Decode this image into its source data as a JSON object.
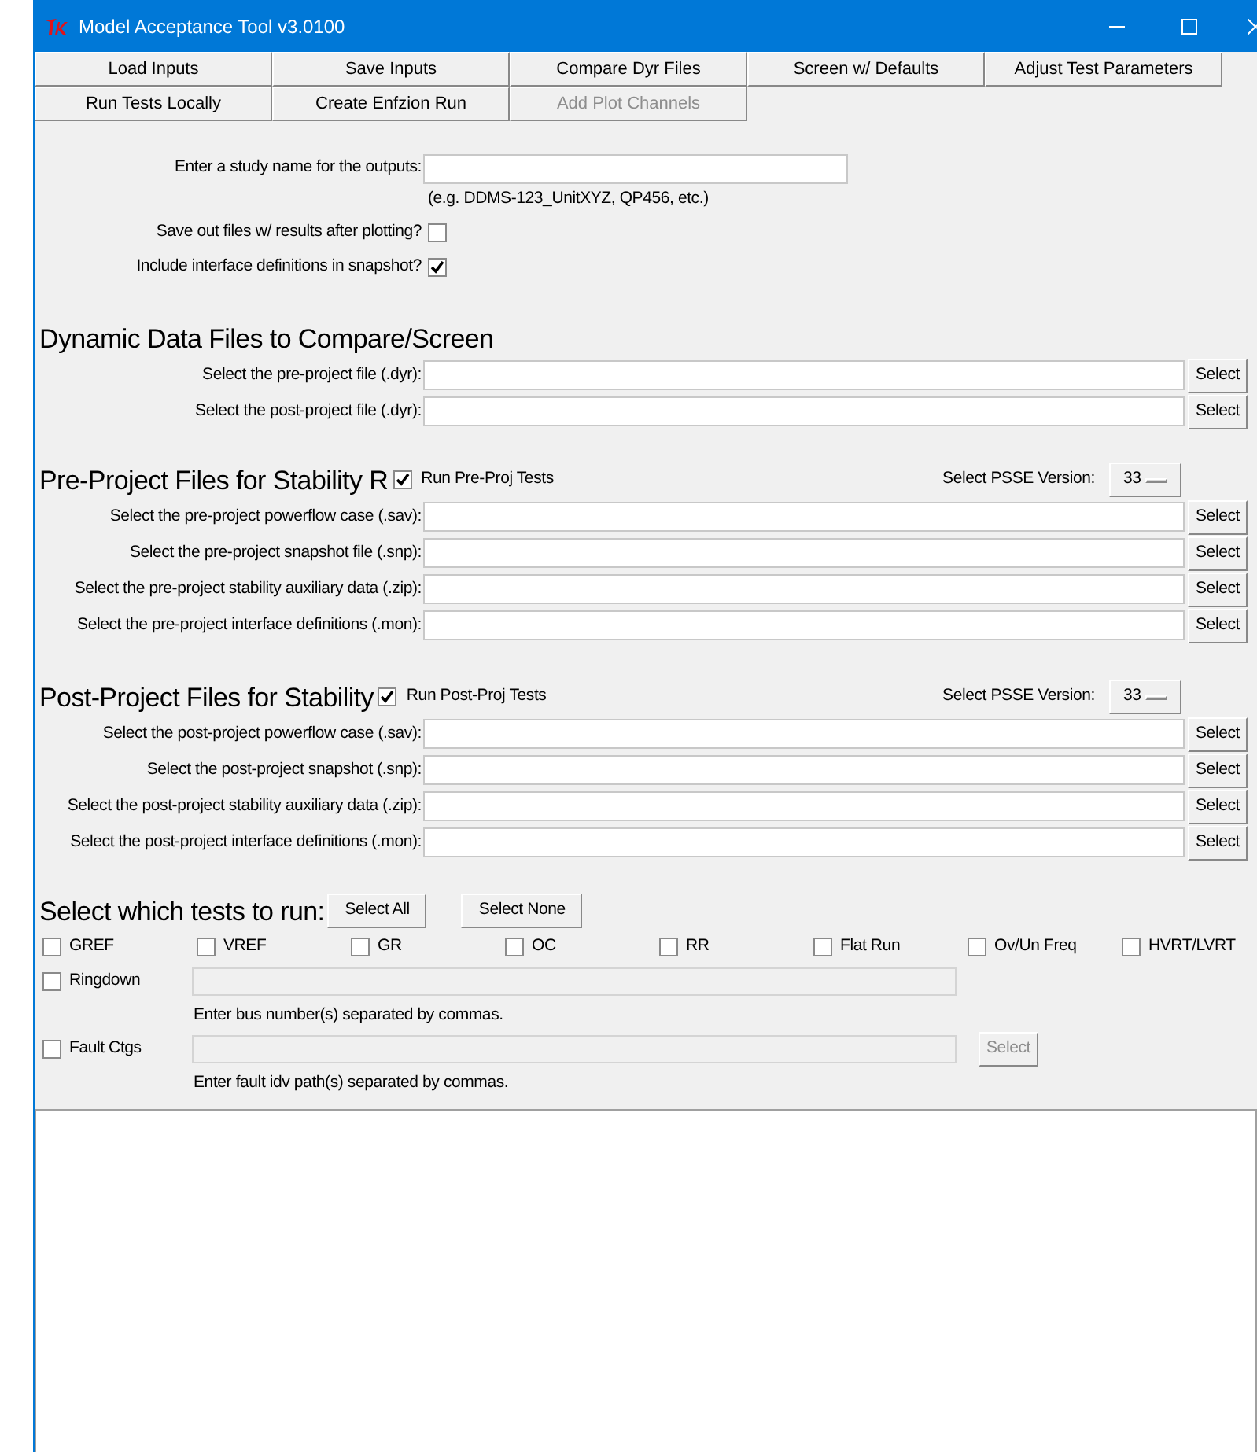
{
  "window": {
    "title": "Model Acceptance Tool v3.0100"
  },
  "toolbar": [
    {
      "label": "Load Inputs",
      "disabled": false
    },
    {
      "label": "Save Inputs",
      "disabled": false
    },
    {
      "label": "Compare Dyr Files",
      "disabled": false
    },
    {
      "label": "Screen w/ Defaults",
      "disabled": false
    },
    {
      "label": "Adjust Test Parameters",
      "disabled": false
    },
    {
      "label": "Run Tests Locally",
      "disabled": false
    },
    {
      "label": "Create Enfzion Run",
      "disabled": false
    },
    {
      "label": "Add Plot Channels",
      "disabled": true
    }
  ],
  "study": {
    "label": "Enter a study name for the outputs:",
    "hint": "(e.g. DDMS-123_UnitXYZ, QP456, etc.)"
  },
  "options": [
    {
      "label": "Save out files w/ results after plotting?",
      "checked": false
    },
    {
      "label": "Include interface definitions in snapshot?",
      "checked": true
    }
  ],
  "sections": [
    {
      "title": "Dynamic Data Files to Compare/Screen",
      "files": [
        {
          "label": "Select the pre-project file (.dyr):",
          "button": "Select"
        },
        {
          "label": "Select the post-project file (.dyr):",
          "button": "Select"
        }
      ]
    },
    {
      "title": "Pre-Project Files for Stability R",
      "run_toggle": {
        "label": "Run Pre-Proj Tests",
        "checked": true
      },
      "version": {
        "label": "Select PSSE Version:",
        "value": "33"
      },
      "files": [
        {
          "label": "Select the pre-project powerflow case (.sav):",
          "button": "Select"
        },
        {
          "label": "Select the pre-project snapshot file (.snp):",
          "button": "Select"
        },
        {
          "label": "Select the pre-project stability auxiliary data (.zip):",
          "button": "Select"
        },
        {
          "label": "Select the pre-project interface definitions (.mon):",
          "button": "Select"
        }
      ]
    },
    {
      "title": "Post-Project Files for Stability",
      "run_toggle": {
        "label": "Run Post-Proj Tests",
        "checked": true
      },
      "version": {
        "label": "Select PSSE Version:",
        "value": "33"
      },
      "files": [
        {
          "label": "Select the post-project powerflow case (.sav):",
          "button": "Select"
        },
        {
          "label": "Select the post-project snapshot (.snp):",
          "button": "Select"
        },
        {
          "label": "Select the post-project stability auxiliary data (.zip):",
          "button": "Select"
        },
        {
          "label": "Select the post-project interface definitions (.mon):",
          "button": "Select"
        }
      ]
    }
  ],
  "tests": {
    "title": "Select which tests to run:",
    "buttons": [
      "Select All",
      "Select None"
    ],
    "items": [
      {
        "label": "GREF",
        "checked": false
      },
      {
        "label": "VREF",
        "checked": false
      },
      {
        "label": "GR",
        "checked": false
      },
      {
        "label": "OC",
        "checked": false
      },
      {
        "label": "RR",
        "checked": false
      },
      {
        "label": "Flat Run",
        "checked": false
      },
      {
        "label": "Ov/Un Freq",
        "checked": false
      },
      {
        "label": "HVRT/LVRT",
        "checked": false
      }
    ],
    "extras": [
      {
        "label": "Ringdown",
        "checked": false,
        "field_disabled": true,
        "hint": "Enter bus number(s) separated by commas."
      },
      {
        "label": "Fault Ctgs",
        "checked": false,
        "field_disabled": true,
        "button": {
          "label": "Select",
          "disabled": true
        },
        "hint": "Enter fault idv path(s) separated by commas."
      }
    ]
  }
}
